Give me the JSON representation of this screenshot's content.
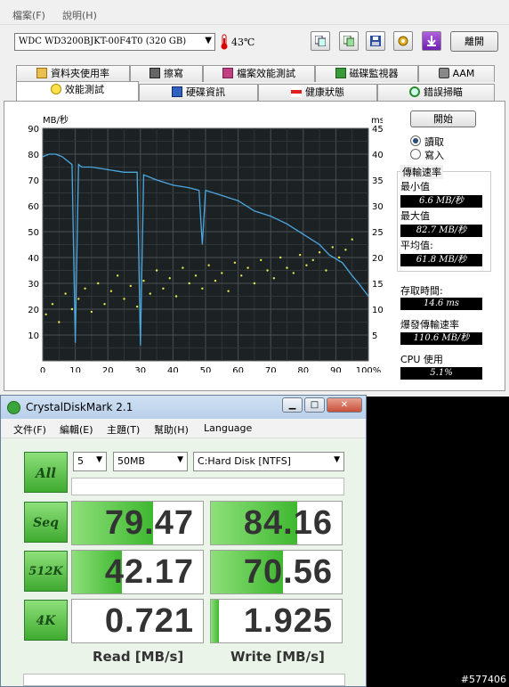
{
  "hdtune": {
    "menu": [
      "檔案(F)",
      "說明(H)"
    ],
    "drive": "WDC WD3200BJKT-00F4T0 (320 GB)",
    "temperature": "43℃",
    "toolbar_icons": [
      "copy-icon",
      "copy-all-icon",
      "save-icon",
      "options-icon",
      "download-icon"
    ],
    "exit_label": "離開",
    "tabs_row1": [
      "資料夾使用率",
      "擦寫",
      "檔案效能測試",
      "磁碟監視器",
      "AAM"
    ],
    "tabs_row2": [
      "效能測試",
      "硬碟資訊",
      "健康狀態",
      "錯誤掃瞄"
    ],
    "active_tab": "效能測試",
    "start_label": "開始",
    "read_label": "讀取",
    "write_label": "寫入",
    "mode": "read",
    "transfer_title": "傳輸速率",
    "min_label": "最小值",
    "min_value": "6.6 MB/秒",
    "max_label": "最大值",
    "max_value": "82.7 MB/秒",
    "avg_label": "平均值:",
    "avg_value": "61.8 MB/秒",
    "access_label": "存取時間:",
    "access_value": "14.6 ms",
    "burst_label": "爆發傳輸速率",
    "burst_value": "110.6 MB/秒",
    "cpu_label": "CPU 使用",
    "cpu_value": "5.1%"
  },
  "chart_data": {
    "type": "line",
    "ylabel_left": "MB/秒",
    "ylabel_right": "ms",
    "ylim_left": [
      0,
      90
    ],
    "ylim_right": [
      0,
      45
    ],
    "yticks_left": [
      "90",
      "80",
      "70",
      "60",
      "50",
      "40",
      "30",
      "20",
      "10"
    ],
    "yticks_right": [
      "45",
      "40",
      "35",
      "30",
      "25",
      "20",
      "15",
      "10",
      "5"
    ],
    "xticks": [
      "0",
      "10",
      "20",
      "30",
      "40",
      "50",
      "60",
      "70",
      "80",
      "90",
      "100%"
    ],
    "series": [
      {
        "color": "#4aa8e0",
        "x": [
          0,
          2,
          4,
          6,
          8,
          9,
          10,
          11,
          12,
          15,
          20,
          25,
          29,
          30,
          31,
          35,
          40,
          45,
          48,
          49,
          50,
          55,
          60,
          65,
          70,
          75,
          80,
          85,
          88,
          92,
          95,
          97,
          100
        ],
        "y": [
          79,
          80,
          80,
          79,
          77,
          76,
          7,
          76,
          75,
          75,
          74,
          73,
          73,
          6,
          72,
          70,
          68,
          67,
          66,
          45,
          66,
          64,
          62,
          58,
          56,
          53,
          49,
          45,
          41,
          38,
          33,
          30,
          25
        ]
      },
      {
        "color": "#e8e84a",
        "type": "scatter",
        "x": [
          1,
          3,
          5,
          7,
          9,
          11,
          13,
          15,
          17,
          19,
          21,
          23,
          25,
          27,
          29,
          31,
          33,
          35,
          37,
          39,
          41,
          43,
          45,
          47,
          49,
          51,
          53,
          55,
          57,
          59,
          61,
          63,
          65,
          67,
          69,
          71,
          73,
          75,
          77,
          79,
          81,
          83,
          85,
          87,
          89,
          91,
          93,
          95
        ],
        "y": [
          18,
          22,
          15,
          26,
          20,
          24,
          28,
          19,
          30,
          22,
          27,
          33,
          24,
          29,
          21,
          31,
          26,
          35,
          28,
          32,
          25,
          36,
          30,
          33,
          28,
          37,
          31,
          34,
          27,
          38,
          33,
          36,
          30,
          39,
          35,
          32,
          40,
          36,
          34,
          41,
          37,
          39,
          42,
          35,
          44,
          40,
          43,
          47
        ]
      }
    ]
  },
  "cdm": {
    "title": "CrystalDiskMark 2.1",
    "menu": [
      "文件(F)",
      "編輯(E)",
      "主題(T)",
      "幫助(H)",
      "Language"
    ],
    "all_label": "All",
    "count": "5",
    "size": "50MB",
    "drive": "C:Hard Disk [NTFS]",
    "rows": [
      {
        "label": "Seq",
        "read": "79.47",
        "write": "84.16",
        "read_pct": 0.62,
        "write_pct": 0.66
      },
      {
        "label": "512K",
        "read": "42.17",
        "write": "70.56",
        "read_pct": 0.38,
        "write_pct": 0.55
      },
      {
        "label": "4K",
        "read": "0.721",
        "write": "1.925",
        "read_pct": 0.0,
        "write_pct": 0.06
      }
    ],
    "read_header": "Read [MB/s]",
    "write_header": "Write [MB/s]"
  },
  "watermark": "#577406"
}
